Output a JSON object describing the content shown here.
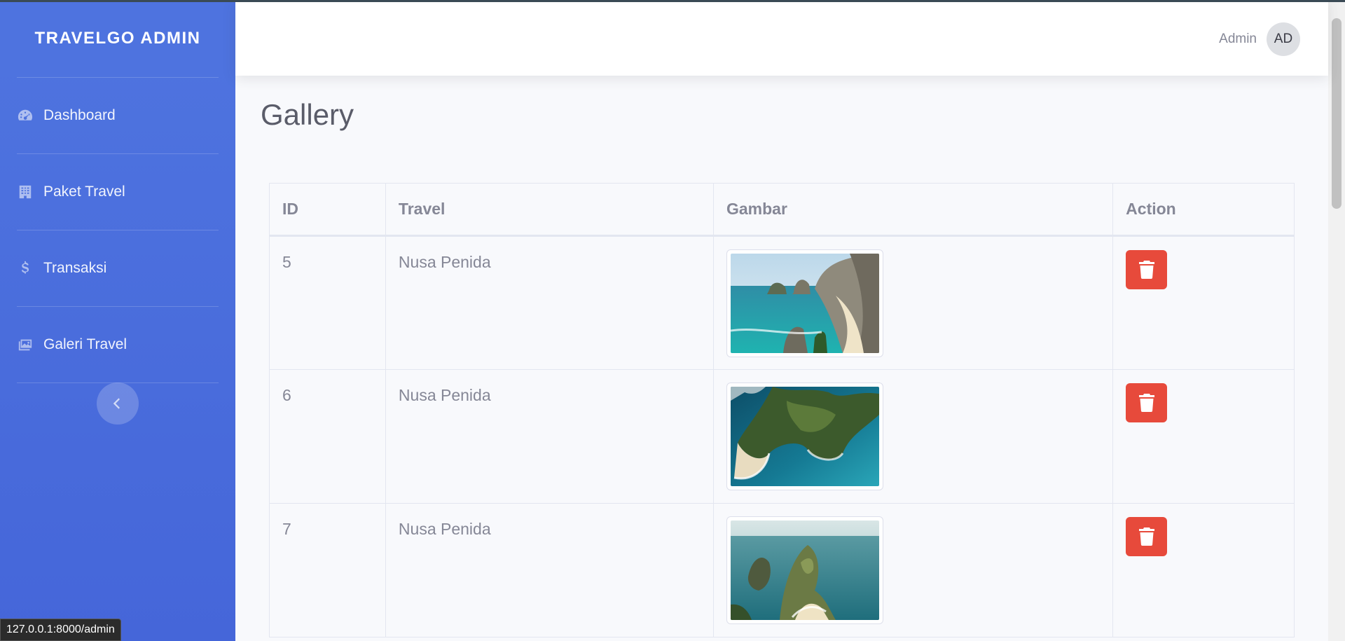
{
  "sidebar": {
    "brand": "TRAVELGO ADMIN",
    "items": [
      {
        "label": "Dashboard",
        "icon": "tachometer-icon"
      },
      {
        "label": "Paket Travel",
        "icon": "building-icon"
      },
      {
        "label": "Transaksi",
        "icon": "dollar-icon"
      },
      {
        "label": "Galeri Travel",
        "icon": "images-icon"
      }
    ]
  },
  "topbar": {
    "user_name": "Admin",
    "avatar_initials": "AD"
  },
  "page": {
    "title": "Gallery"
  },
  "table": {
    "headers": [
      "ID",
      "Travel",
      "Gambar",
      "Action"
    ],
    "rows": [
      {
        "id": "5",
        "travel": "Nusa Penida",
        "image": "beach-cliffs-photo"
      },
      {
        "id": "6",
        "travel": "Nusa Penida",
        "image": "aerial-coast-photo"
      },
      {
        "id": "7",
        "travel": "Nusa Penida",
        "image": "kelingking-cliff-photo"
      }
    ]
  },
  "status_bar": {
    "url": "127.0.0.1:8000/admin"
  },
  "colors": {
    "sidebar": "#4e73df",
    "danger": "#e74a3b",
    "text_muted": "#858796"
  }
}
